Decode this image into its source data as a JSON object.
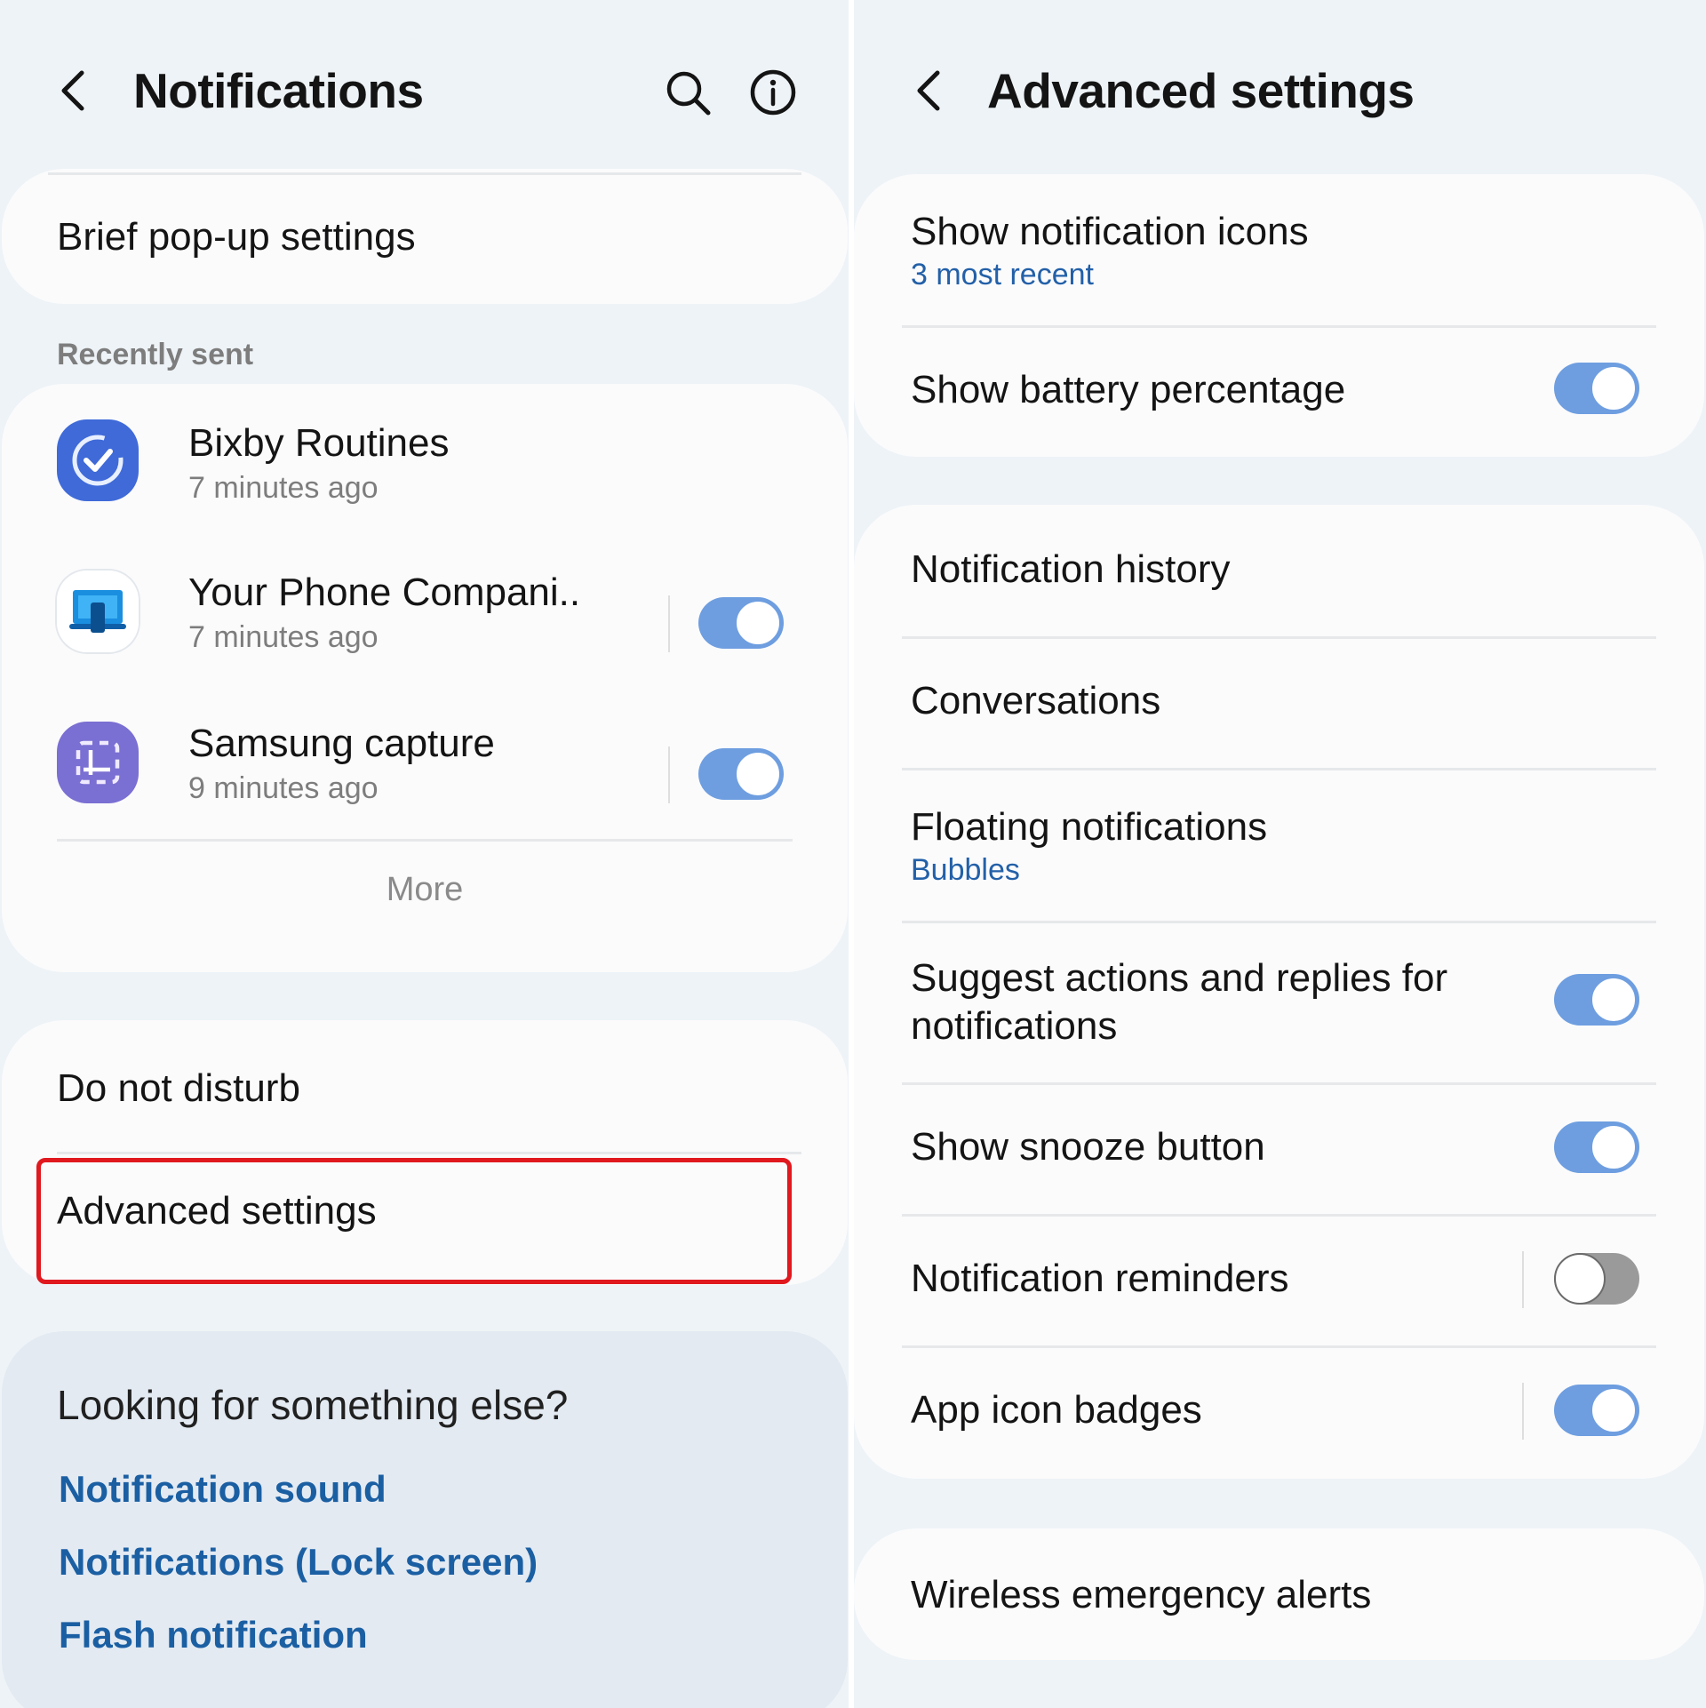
{
  "left": {
    "title": "Notifications",
    "brief_popup": "Brief pop-up settings",
    "recently_sent_label": "Recently sent",
    "apps": [
      {
        "name": "Bixby Routines",
        "time": "7 minutes ago",
        "icon": "bixby-routines-icon",
        "toggle": null
      },
      {
        "name": "Your Phone Compani..",
        "time": "7 minutes ago",
        "icon": "phone-companion-icon",
        "toggle": true
      },
      {
        "name": "Samsung capture",
        "time": "9 minutes ago",
        "icon": "samsung-capture-icon",
        "toggle": true
      }
    ],
    "more": "More",
    "do_not_disturb": "Do not disturb",
    "advanced_settings": "Advanced settings",
    "looking_title": "Looking for something else?",
    "links": [
      "Notification sound",
      "Notifications (Lock screen)",
      "Flash notification"
    ]
  },
  "right": {
    "title": "Advanced settings",
    "card1": [
      {
        "label": "Show notification icons",
        "sub": "3 most recent"
      },
      {
        "label": "Show battery percentage",
        "toggle": true
      }
    ],
    "card2": [
      {
        "label": "Notification history"
      },
      {
        "label": "Conversations"
      },
      {
        "label": "Floating notifications",
        "sub": "Bubbles"
      },
      {
        "label_line1": "Suggest actions and replies for",
        "label_line2": "notifications",
        "toggle": true
      },
      {
        "label": "Show snooze button",
        "toggle": true
      },
      {
        "label": "Notification reminders",
        "toggle": false
      },
      {
        "label": "App icon badges",
        "toggle": true
      }
    ],
    "card3": [
      {
        "label": "Wireless emergency alerts"
      }
    ]
  },
  "colors": {
    "background": "#eef3f7",
    "card": "#fbfbfc",
    "accent_blue": "#1b5fa3",
    "toggle_on": "#6e9ee0",
    "highlight_red": "#e0191f"
  }
}
